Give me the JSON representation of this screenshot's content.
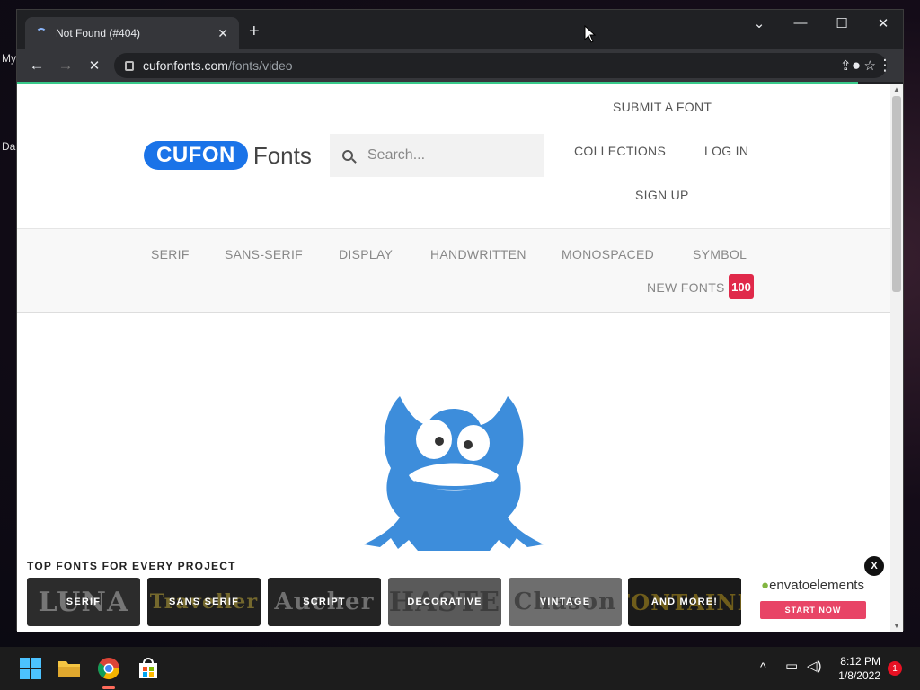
{
  "desktop": {
    "labels": [
      "My",
      "Da"
    ]
  },
  "browser": {
    "tab_title": "Not Found (#404)",
    "url_host": "cufonfonts.com",
    "url_path": "/fonts/video"
  },
  "site": {
    "logo_pill": "CUFON",
    "logo_text": "Fonts",
    "search_placeholder": "Search...",
    "nav": {
      "submit": "SUBMIT A FONT",
      "collections": "COLLECTIONS",
      "login": "LOG IN",
      "signup": "SIGN UP"
    },
    "categories": [
      "SERIF",
      "SANS-SERIF",
      "DISPLAY",
      "HANDWRITTEN",
      "MONOSPACED",
      "SYMBOL"
    ],
    "new_fonts": "NEW FONTS",
    "new_fonts_count": "100"
  },
  "ad": {
    "title": "TOP FONTS FOR EVERY PROJECT",
    "cards": [
      {
        "label": "SERIF",
        "bg_text": "LUNA",
        "color": "#2c2c2c"
      },
      {
        "label": "SANS SERIF",
        "bg_text": "Traveller",
        "color": "#1f1f1f"
      },
      {
        "label": "SCRIPT",
        "bg_text": "Aucher",
        "color": "#242424"
      },
      {
        "label": "DECORATIVE",
        "bg_text": "HASTE",
        "color": "#5a5a5a"
      },
      {
        "label": "VINTAGE",
        "bg_text": "Chason",
        "color": "#6e6e6e"
      },
      {
        "label": "AND MORE!",
        "bg_text": "FONTAINE",
        "color": "#1a1a1a"
      }
    ],
    "brand": "envatoelements",
    "cta": "START NOW",
    "close": "X"
  },
  "taskbar": {
    "time": "8:12 PM",
    "date": "1/8/2022",
    "notification_count": "1"
  },
  "colors": {
    "brand_blue": "#1a73e8",
    "badge_red": "#e0294a",
    "cta_pink": "#e84466"
  }
}
